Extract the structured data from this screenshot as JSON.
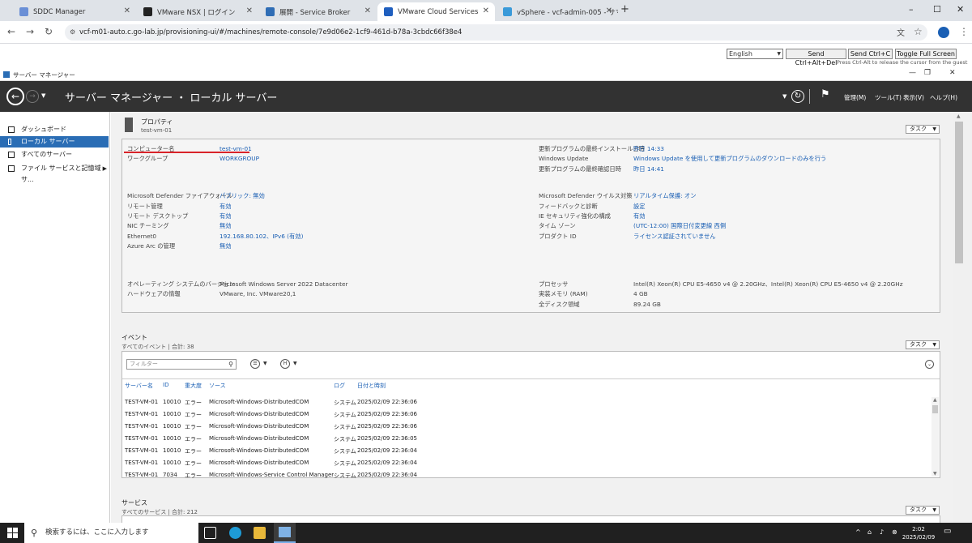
{
  "browser": {
    "tabs": [
      {
        "label": "SDDC Manager",
        "color": "#6a8fd6"
      },
      {
        "label": "VMware NSX | ログイン",
        "color": "#222222"
      },
      {
        "label": "展開 - Service Broker",
        "color": "#2f6db5"
      },
      {
        "label": "VMware Cloud Services",
        "color": "#1f5fbf",
        "active": true
      },
      {
        "label": "vSphere - vcf-admin-005 - サマ",
        "color": "#3a9ad9"
      }
    ],
    "new_tab": "+",
    "window_controls": {
      "minimize": "–",
      "maximize": "☐",
      "close": "✕"
    },
    "url": "vcf-m01-auto.c.go-lab.jp/provisioning-ui/#/machines/remote-console/7e9d06e2-1cf9-461d-b78a-3cbdc66f38e4"
  },
  "console": {
    "language": "English",
    "buttons": [
      "Send Ctrl+Alt+Del",
      "Send Ctrl+C",
      "Toggle Full Screen"
    ],
    "note": "Press Ctrl-Alt to release the cursor from the guest"
  },
  "servermanager": {
    "window_title": "サーバー マネージャー",
    "breadcrumb": "サーバー マネージャー ・ ローカル サーバー",
    "menus": [
      "管理(M)",
      "ツール(T)",
      "表示(V)",
      "ヘルプ(H)"
    ],
    "sidebar": [
      {
        "label": "ダッシュボード"
      },
      {
        "label": "ローカル サーバー",
        "active": true
      },
      {
        "label": "すべてのサーバー"
      },
      {
        "label": "ファイル サービスと記憶域サ..."
      }
    ],
    "properties": {
      "title": "プロパティ",
      "subtitle": "test-vm-01",
      "task": "タスク",
      "left": [
        {
          "label": "コンピューター名",
          "value": "test-vm-01",
          "link": true
        },
        {
          "label": "ワークグループ",
          "value": "WORKGROUP",
          "link": true
        },
        {
          "label": "Microsoft Defender ファイアウォール",
          "value": "パブリック: 無効",
          "link": true
        },
        {
          "label": "リモート管理",
          "value": "有効",
          "link": true
        },
        {
          "label": "リモート デスクトップ",
          "value": "有効",
          "link": true
        },
        {
          "label": "NIC チーミング",
          "value": "無効",
          "link": true
        },
        {
          "label": "Ethernet0",
          "value": "192.168.80.102、IPv6 (有効)",
          "link": true
        },
        {
          "label": "Azure Arc の管理",
          "value": "無効",
          "link": true
        },
        {
          "label": "オペレーティング システムのバージョン",
          "value": "Microsoft Windows Server 2022 Datacenter",
          "link": false
        },
        {
          "label": "ハードウェアの情報",
          "value": "VMware, Inc. VMware20,1",
          "link": false
        }
      ],
      "right": [
        {
          "label": "更新プログラムの最終インストール日時",
          "value": "昨日 14:33",
          "link": true
        },
        {
          "label": "Windows Update",
          "value": "Windows Update を使用して更新プログラムのダウンロードのみを行う",
          "link": true
        },
        {
          "label": "更新プログラムの最終確認日時",
          "value": "昨日 14:41",
          "link": true
        },
        {
          "label": "Microsoft Defender ウイルス対策",
          "value": "リアルタイム保護: オン",
          "link": true
        },
        {
          "label": "フィードバックと診断",
          "value": "設定",
          "link": true
        },
        {
          "label": "IE セキュリティ強化の構成",
          "value": "有効",
          "link": true
        },
        {
          "label": "タイム ゾーン",
          "value": "(UTC-12:00) 国際日付変更線 西側",
          "link": true
        },
        {
          "label": "プロダクト ID",
          "value": "ライセンス認証されていません",
          "link": true
        },
        {
          "label": "プロセッサ",
          "value": "Intel(R) Xeon(R) CPU E5-4650 v4 @ 2.20GHz、Intel(R) Xeon(R) CPU E5-4650 v4 @ 2.20GHz",
          "link": false
        },
        {
          "label": "実装メモリ (RAM)",
          "value": "4 GB",
          "link": false
        },
        {
          "label": "全ディスク領域",
          "value": "89.24 GB",
          "link": false
        }
      ]
    },
    "events": {
      "title": "イベント",
      "subtitle": "すべてのイベント | 合計: 38",
      "task": "タスク",
      "filter_placeholder": "フィルター",
      "columns": [
        "サーバー名",
        "ID",
        "重大度",
        "ソース",
        "ログ",
        "日付と時刻"
      ],
      "rows": [
        [
          "TEST-VM-01",
          "10010",
          "エラー",
          "Microsoft-Windows-DistributedCOM",
          "システム",
          "2025/02/09 22:36:06"
        ],
        [
          "TEST-VM-01",
          "10010",
          "エラー",
          "Microsoft-Windows-DistributedCOM",
          "システム",
          "2025/02/09 22:36:06"
        ],
        [
          "TEST-VM-01",
          "10010",
          "エラー",
          "Microsoft-Windows-DistributedCOM",
          "システム",
          "2025/02/09 22:36:06"
        ],
        [
          "TEST-VM-01",
          "10010",
          "エラー",
          "Microsoft-Windows-DistributedCOM",
          "システム",
          "2025/02/09 22:36:05"
        ],
        [
          "TEST-VM-01",
          "10010",
          "エラー",
          "Microsoft-Windows-DistributedCOM",
          "システム",
          "2025/02/09 22:36:04"
        ],
        [
          "TEST-VM-01",
          "10010",
          "エラー",
          "Microsoft-Windows-DistributedCOM",
          "システム",
          "2025/02/09 22:36:04"
        ],
        [
          "TEST-VM-01",
          "7034",
          "エラー",
          "Microsoft-Windows-Service Control Manager",
          "システム",
          "2025/02/09 22:36:04"
        ]
      ]
    },
    "services": {
      "title": "サービス",
      "subtitle": "すべてのサービス | 合計: 212",
      "task": "タスク"
    }
  },
  "taskbar": {
    "search_placeholder": "検索するには、ここに入力します",
    "time": "2:02",
    "date": "2025/02/09"
  }
}
